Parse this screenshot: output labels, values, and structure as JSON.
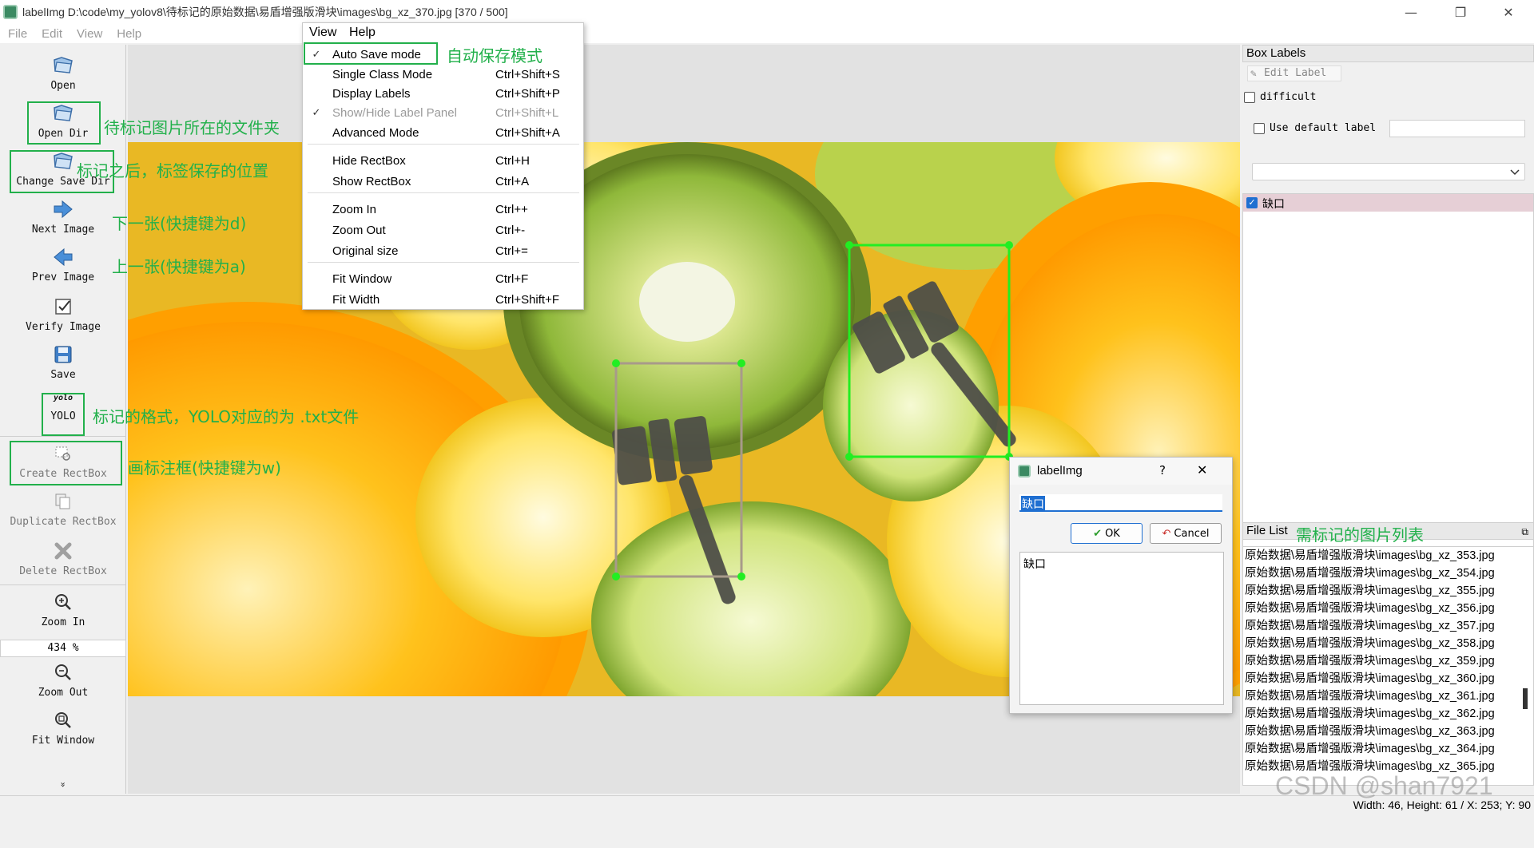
{
  "window": {
    "title": "labelImg D:\\code\\my_yolov8\\待标记的原始数据\\易盾增强版滑块\\images\\bg_xz_370.jpg [370 / 500]",
    "minimize_glyph": "—",
    "maximize_glyph": "❐",
    "close_glyph": "✕"
  },
  "menubar": {
    "items": [
      "File",
      "Edit",
      "View",
      "Help"
    ],
    "open_menu_bar": [
      "View",
      "Help"
    ]
  },
  "toolbar": {
    "open": "Open",
    "open_dir": "Open Dir",
    "change_save_dir": "Change Save Dir",
    "next_image": "Next Image",
    "prev_image": "Prev Image",
    "verify_image": "Verify Image",
    "save": "Save",
    "format_small": "yolo",
    "format": "YOLO",
    "create_rectbox": "Create RectBox",
    "duplicate_rectbox": "Duplicate RectBox",
    "delete_rectbox": "Delete RectBox",
    "zoom_in": "Zoom In",
    "zoom_value": "434 %",
    "zoom_out": "Zoom Out",
    "fit_window": "Fit Window",
    "more": "»"
  },
  "view_menu": {
    "items": [
      {
        "label": "Auto Save mode",
        "shortcut": "",
        "checked": true,
        "disabled": false
      },
      {
        "label": "Single Class Mode",
        "shortcut": "Ctrl+Shift+S",
        "checked": false,
        "disabled": false
      },
      {
        "label": "Display Labels",
        "shortcut": "Ctrl+Shift+P",
        "checked": false,
        "disabled": false
      },
      {
        "label": "Show/Hide Label Panel",
        "shortcut": "Ctrl+Shift+L",
        "checked": true,
        "disabled": true
      },
      {
        "label": "Advanced Mode",
        "shortcut": "Ctrl+Shift+A",
        "checked": false,
        "disabled": false
      },
      {
        "label": "Hide RectBox",
        "shortcut": "Ctrl+H",
        "checked": false,
        "disabled": false
      },
      {
        "label": "Show RectBox",
        "shortcut": "Ctrl+A",
        "checked": false,
        "disabled": false
      },
      {
        "label": "Zoom In",
        "shortcut": "Ctrl++",
        "checked": false,
        "disabled": false
      },
      {
        "label": "Zoom Out",
        "shortcut": "Ctrl+-",
        "checked": false,
        "disabled": false
      },
      {
        "label": "Original size",
        "shortcut": "Ctrl+=",
        "checked": false,
        "disabled": false
      },
      {
        "label": "Fit Window",
        "shortcut": "Ctrl+F",
        "checked": false,
        "disabled": false
      },
      {
        "label": "Fit Width",
        "shortcut": "Ctrl+Shift+F",
        "checked": false,
        "disabled": false
      }
    ],
    "check_glyph": "✓"
  },
  "annotations": {
    "auto_save": "自动保存模式",
    "open_dir": "待标记图片所在的文件夹",
    "change_save_dir": "标记之后，标签保存的位置",
    "next_image": "下一张(快捷键为d)",
    "prev_image": "上一张(快捷键为a)",
    "format": "标记的格式，YOLO对应的为 .txt文件",
    "create_rectbox": "画标注框(快捷键为w)",
    "file_list": "需标记的图片列表"
  },
  "box_labels": {
    "title": "Box Labels",
    "edit_label": "Edit Label",
    "difficult": "difficult",
    "use_default_label": "Use default label",
    "default_label_value": "",
    "labels": [
      {
        "text": "缺口",
        "checked": true
      }
    ]
  },
  "file_list": {
    "title": "File List",
    "float_glyph": "⧉",
    "files": [
      "原始数据\\易盾增强版滑块\\images\\bg_xz_353.jpg",
      "原始数据\\易盾增强版滑块\\images\\bg_xz_354.jpg",
      "原始数据\\易盾增强版滑块\\images\\bg_xz_355.jpg",
      "原始数据\\易盾增强版滑块\\images\\bg_xz_356.jpg",
      "原始数据\\易盾增强版滑块\\images\\bg_xz_357.jpg",
      "原始数据\\易盾增强版滑块\\images\\bg_xz_358.jpg",
      "原始数据\\易盾增强版滑块\\images\\bg_xz_359.jpg",
      "原始数据\\易盾增强版滑块\\images\\bg_xz_360.jpg",
      "原始数据\\易盾增强版滑块\\images\\bg_xz_361.jpg",
      "原始数据\\易盾增强版滑块\\images\\bg_xz_362.jpg",
      "原始数据\\易盾增强版滑块\\images\\bg_xz_363.jpg",
      "原始数据\\易盾增强版滑块\\images\\bg_xz_364.jpg",
      "原始数据\\易盾增强版滑块\\images\\bg_xz_365.jpg"
    ]
  },
  "dialog": {
    "title": "labelImg",
    "help_glyph": "?",
    "close_glyph": "✕",
    "input_value": "缺口",
    "ok": "OK",
    "cancel": "Cancel",
    "list_items": [
      "缺口"
    ]
  },
  "status": {
    "text": "Width: 46, Height: 61 / X: 253; Y: 90"
  },
  "watermark": "CSDN @shan7921",
  "colors": {
    "annotation": "#22b04b",
    "box_active": "#22ee22",
    "box_other": "#a89a8a",
    "label_row_bg": "#e6cfd6"
  }
}
